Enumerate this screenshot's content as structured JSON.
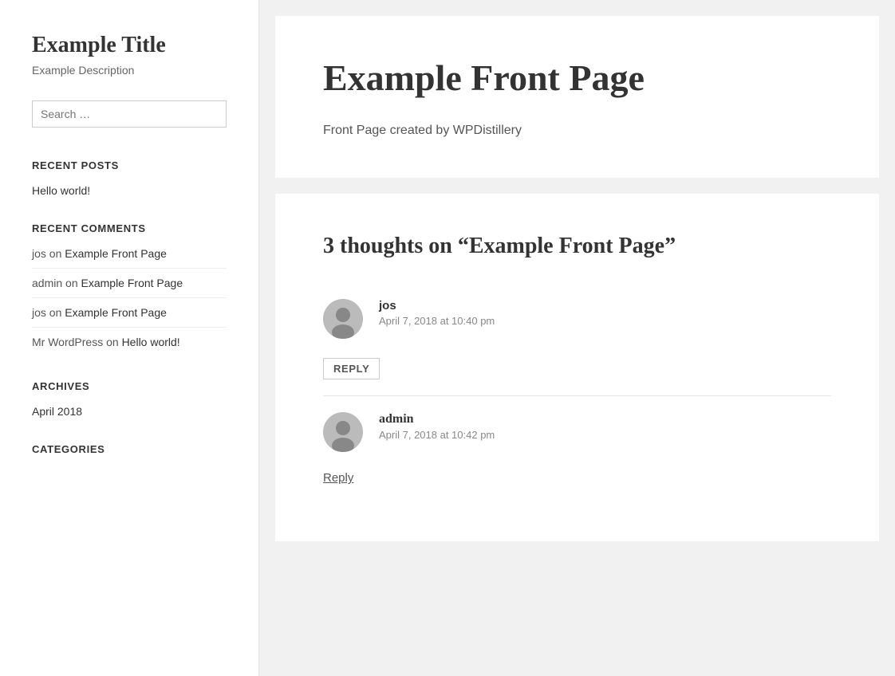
{
  "sidebar": {
    "site_title": "Example Title",
    "site_description": "Example Description",
    "search_placeholder": "Search …",
    "recent_posts_label": "Recent Posts",
    "recent_comments_label": "Recent Comments",
    "archives_label": "Archives",
    "categories_label": "Categories",
    "recent_posts": [
      {
        "title": "Hello world!",
        "url": "#"
      }
    ],
    "recent_comments": [
      {
        "author": "jos",
        "preposition": "on",
        "post": "Example Front Page"
      },
      {
        "author": "admin",
        "preposition": "on",
        "post": "Example Front Page"
      },
      {
        "author": "jos",
        "preposition": "on",
        "post": "Example Front Page"
      },
      {
        "author": "Mr WordPress",
        "preposition": "on",
        "post": "Hello world!"
      }
    ],
    "archives": [
      {
        "label": "April 2018",
        "url": "#"
      }
    ]
  },
  "main": {
    "front_page": {
      "title": "Example Front Page",
      "description": "Front Page created by WPDistillery"
    },
    "comments": {
      "heading": "3 thoughts on “Example Front Page”",
      "items": [
        {
          "author": "jos",
          "author_is_link": false,
          "date": "April 7, 2018 at 10:40 pm",
          "reply_style": "button",
          "reply_label": "REPLY"
        },
        {
          "author": "admin",
          "author_is_link": true,
          "date": "April 7, 2018 at 10:42 pm",
          "reply_style": "link",
          "reply_label": "Reply"
        }
      ]
    }
  }
}
